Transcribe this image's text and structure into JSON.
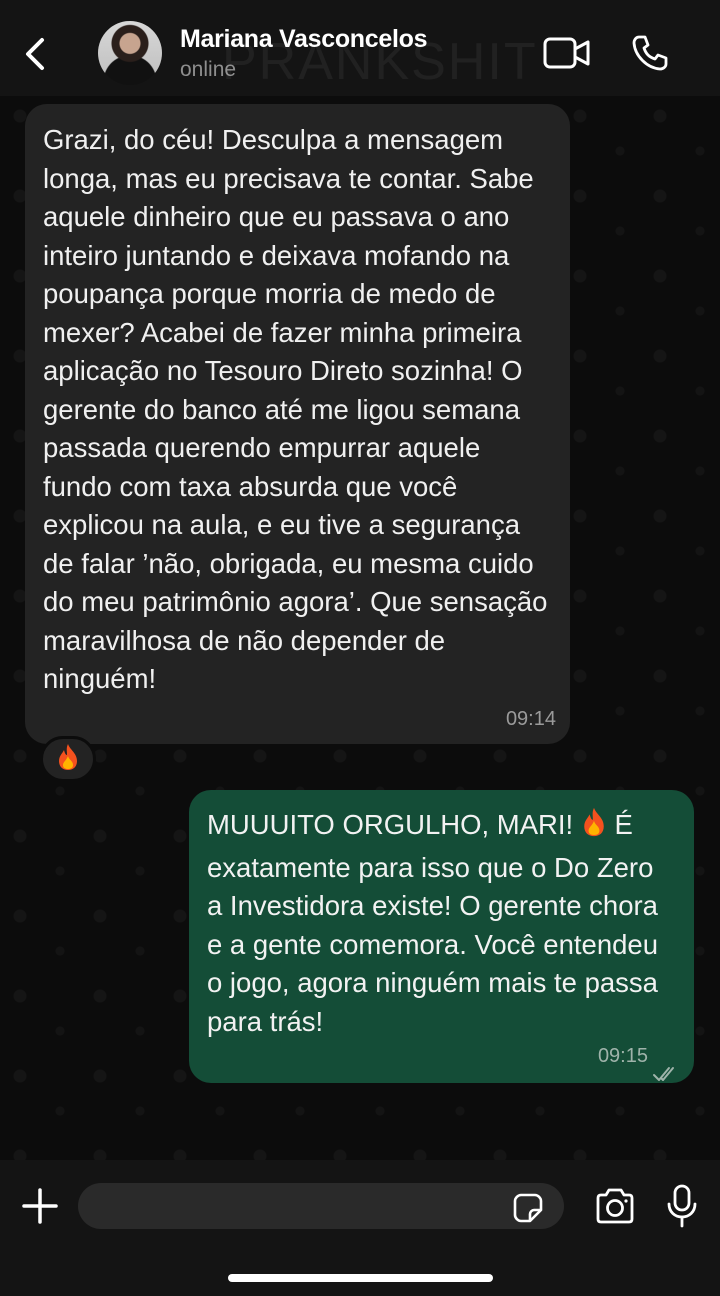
{
  "header": {
    "contact_name": "Mariana Vasconcelos",
    "status": "online"
  },
  "watermark": "PRANKSHIT",
  "messages": [
    {
      "direction": "incoming",
      "text": "Grazi, do céu! Desculpa a mensagem longa, mas eu precisava te contar. Sabe aquele dinheiro que eu passava o ano inteiro juntando e deixava mofando na poupança porque morria de medo de mexer? Acabei de fazer minha primeira aplicação no Tesouro Direto sozinha! O gerente do banco até me ligou semana passada querendo empurrar aquele fundo com taxa absurda que você explicou na aula, e eu tive a segurança de falar ’não, obrigada, eu mesma cuido do meu patrimônio agora’. Que sensação maravilhosa de não depender de ninguém!",
      "time": "09:14",
      "reaction": "🔥"
    },
    {
      "direction": "outgoing",
      "text_before_emoji": "MUUUITO ORGULHO, MARI! ",
      "emoji": "🔥",
      "text_after_emoji": " É exatamente para isso que o Do Zero a Investidora existe! O gerente chora e a gente comemora. Você entendeu o jogo, agora ninguém mais te passa para trás!",
      "time": "09:15",
      "status": "read"
    }
  ],
  "composer": {
    "placeholder": ""
  },
  "colors": {
    "header_bg": "#141414",
    "incoming_bubble": "#232323",
    "outgoing_bubble": "#144d37",
    "background": "#0c0c0c"
  },
  "icons": [
    "back-arrow-icon",
    "video-camera-icon",
    "phone-icon",
    "plus-icon",
    "sticker-icon",
    "camera-icon",
    "microphone-icon",
    "double-check-icon",
    "fire-icon"
  ]
}
